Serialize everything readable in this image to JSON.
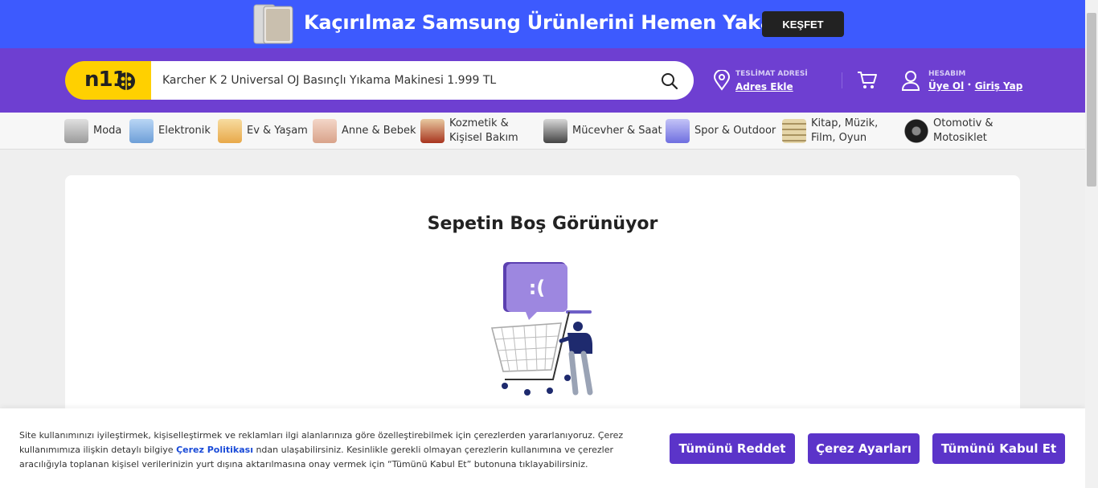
{
  "promo": {
    "text": "Kaçırılmaz Samsung Ürünlerini Hemen Yakala",
    "button": "KEŞFET"
  },
  "header": {
    "logo": "n11",
    "search_value": "Karcher K 2 Universal OJ Basınçlı Yıkama Makinesi 1.999 TL",
    "address_caption": "TESLİMAT ADRESİ",
    "address_link": "Adres Ekle",
    "account_caption": "HESABIM",
    "signup_link": "Üye Ol",
    "separator": "•",
    "login_link": "Giriş Yap"
  },
  "categories": [
    {
      "label": "Moda",
      "color": "#b9b9b9"
    },
    {
      "label": "Elektronik",
      "color": "#8fb8e6"
    },
    {
      "label": "Ev & Yaşam",
      "color": "#f0c879"
    },
    {
      "label": "Anne & Bebek",
      "color": "#e8c2b0"
    },
    {
      "label": "Kozmetik &\nKişisel Bakım",
      "color": "#b8412f"
    },
    {
      "label": "Mücevher & Saat",
      "color": "#555555"
    },
    {
      "label": "Spor & Outdoor",
      "color": "#8e8ef0"
    },
    {
      "label": "Kitap, Müzik,\nFilm, Oyun",
      "color": "#c9b98a"
    },
    {
      "label": "Otomotiv &\nMotosiklet",
      "color": "#2a2a2a"
    }
  ],
  "main": {
    "title": "Sepetin Boş Görünüyor",
    "bubble_text": ":("
  },
  "cookie": {
    "text_before": "Site kullanımınızı iyileştirmek, kişiselleştirmek ve reklamları ilgi alanlarınıza göre özelleştirebilmek için çerezlerden yararlanıyoruz. Çerez kullanımımıza ilişkin detaylı bilgiye ",
    "policy_link": "Çerez Politikası",
    "text_after": " ndan ulaşabilirsiniz. Kesinlikle gerekli olmayan çerezlerin kullanımına ve çerezler aracılığıyla toplanan kişisel verilerinizin yurt dışına aktarılmasına onay vermek için “Tümünü Kabul Et” butonuna tıklayabilirsiniz.",
    "reject_button": "Tümünü Reddet",
    "settings_button": "Çerez Ayarları",
    "accept_button": "Tümünü Kabul Et"
  },
  "colors": {
    "promo_bg": "#3d5afe",
    "header_bg": "#6e3fd1",
    "logo_bg": "#ffd000",
    "primary_button": "#5b34c9",
    "link": "#1a4bd8"
  }
}
